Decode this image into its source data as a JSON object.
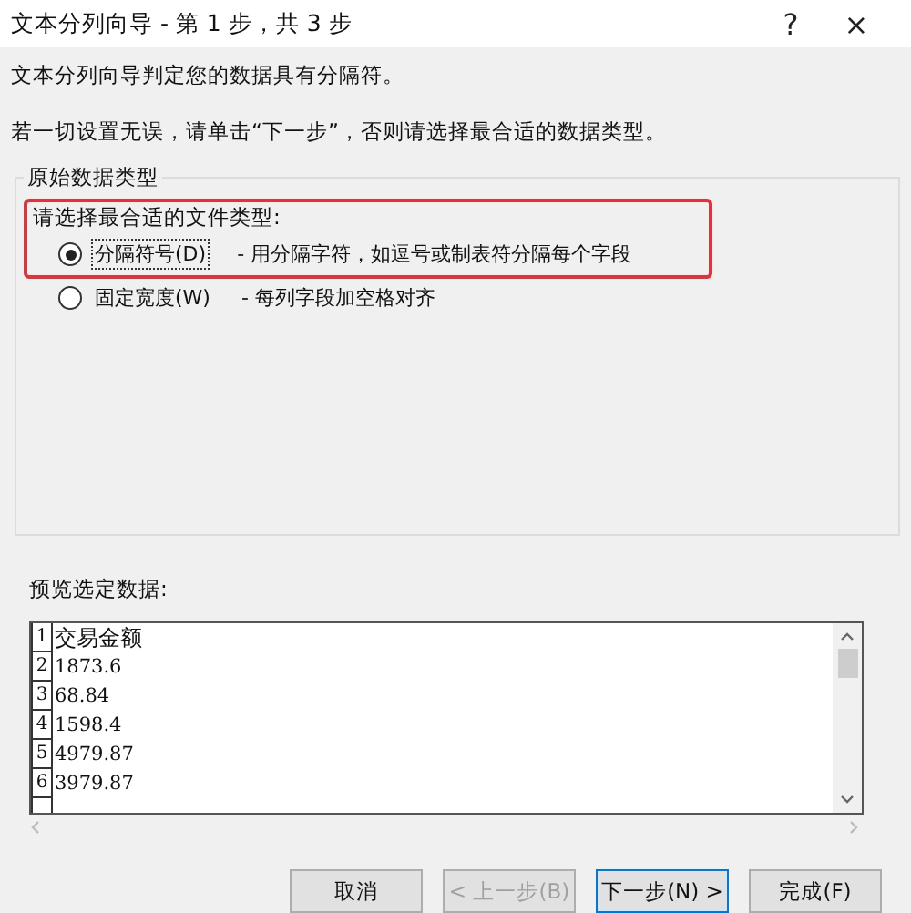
{
  "window": {
    "title": "文本分列向导 - 第 1 步，共 3 步",
    "help": "?",
    "close": "×"
  },
  "intro": [
    "文本分列向导判定您的数据具有分隔符。",
    "若一切设置无误，请单击“下一步”，否则请选择最合适的数据类型。"
  ],
  "group": {
    "title": "原始数据类型",
    "prompt": "请选择最合适的文件类型:",
    "highlighted": true,
    "options": [
      {
        "label": "分隔符号(D)",
        "description": "- 用分隔字符，如逗号或制表符分隔每个字段",
        "selected": true
      },
      {
        "label": "固定宽度(W)",
        "description": "- 每列字段加空格对齐",
        "selected": false
      }
    ]
  },
  "preview": {
    "label": "预览选定数据:",
    "rows": [
      {
        "num": "1",
        "text": "交易金额"
      },
      {
        "num": "2",
        "text": "1873.6"
      },
      {
        "num": "3",
        "text": "68.84"
      },
      {
        "num": "4",
        "text": "1598.4"
      },
      {
        "num": "5",
        "text": "4979.87"
      },
      {
        "num": "6",
        "text": "3979.87"
      }
    ]
  },
  "buttons": [
    {
      "label": "取消",
      "disabled": false,
      "default": false
    },
    {
      "label": "< 上一步(B)",
      "disabled": true,
      "default": false
    },
    {
      "label": "下一步(N) >",
      "disabled": false,
      "default": true
    },
    {
      "label": "完成(F)",
      "disabled": false,
      "default": false
    }
  ]
}
